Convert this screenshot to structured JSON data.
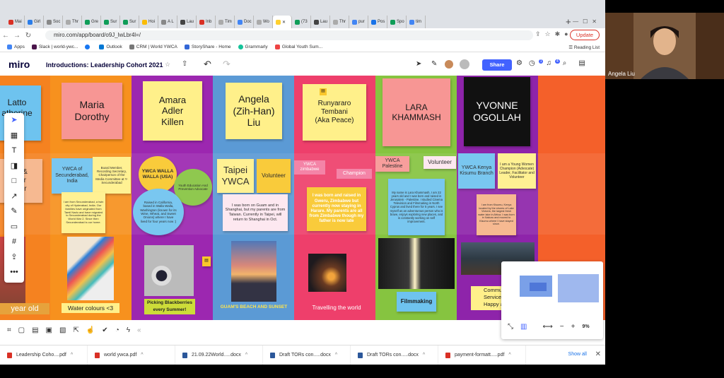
{
  "browser": {
    "tabs": [
      "Mai",
      "Girl",
      "Soc",
      "Thr",
      "Gre",
      "Sur",
      "Sur",
      "Hoi",
      "A L",
      "Lau",
      "Inb",
      "Tim",
      "Doc",
      "Wo",
      "",
      "(73",
      "Lau",
      "Thr",
      "pur",
      "Pos",
      "Spo",
      "tim"
    ],
    "url": "miro.com/app/board/o9J_lwLbr4l=/",
    "update_label": "Update",
    "bookmarks": [
      "Apps",
      "Slack | world-ywc...",
      "Outlook",
      "CRM | World YWCA",
      "StoryShare - Home",
      "Grammarly",
      "Global Youth Sum..."
    ],
    "reading_list": "Reading List"
  },
  "miro": {
    "logo": "miro",
    "board_title": "Introductions: Leadership Cohort 2021",
    "share_label": "Share",
    "badges": {
      "timer": "1",
      "notifications": "4"
    },
    "zoom": "9%"
  },
  "board": {
    "col0": {
      "name_lines": [
        "Latto",
        "atherine",
        "T    o"
      ],
      "role_lines": [
        "HR &",
        "nder",
        "visor"
      ],
      "caption": "year old"
    },
    "col1": {
      "name_lines": [
        "Maria",
        "Dorothy"
      ],
      "org": "YWCA of Secunderabad, India",
      "role": "Board Member, Recording Secretary, Chairperson of the Media Committee at Y-Secunderabad",
      "bio": "I am from Secunderabad, a twin city of Hyderabad, India. Our families have originated from Tamil Nadu and have migrated to Secunderabad during the World War 2. Since then Secunderabad is our home.",
      "caption": "Water colours <3"
    },
    "col2": {
      "name_lines": [
        "Amara",
        "Adler",
        "Killen"
      ],
      "org": "YWCA WALLA WALLA (USA)",
      "role": "Youth Education And Prevention Advocate",
      "bio": "Raised in California, based in Walla Walla, Washington (known for its Wine, Wheat, and Sweet Onions) where I have lived for four years now :)",
      "caption_lines": [
        "Picking Blackberries",
        "every Summer!"
      ]
    },
    "col3": {
      "name_lines": [
        "Angela",
        "(Zih-Han)",
        "Liu"
      ],
      "org_lines": [
        "Taipei",
        "YWCA"
      ],
      "role": "Volunteer",
      "bio": "I was born on Guam and in Shanghai, but my parents are from Taiwan. Currently in Taipei, will return to Shanghai in Oct.",
      "caption": "GUAM'S BEACH AND SUNSET"
    },
    "col4": {
      "name_lines": [
        "Runyararo",
        "Tembani",
        "(Aka Peace)"
      ],
      "org": "YWCA zimbabwe",
      "role": "Champion",
      "bio": "I was born and raised in Gweru, Zimbabwe but currently now staying in Harare. My parents are all from Zimbabwe though my father is now late",
      "caption": "Travelling the world"
    },
    "col5": {
      "name_lines": [
        "LARA",
        "KHAMMASH"
      ],
      "org": "YWCA Palestine",
      "role": "Volunteer",
      "bio": "My name is Lara Khammash, I am 22 years old and I was born and raised in Jerusalem - Palestine. I studied Cinema Television and Filmmaking in North Cyprus and lived there for 5 years. I see myself as an adventurous person who is brave, enjoys exploring new places, and is constantly working on self improvement.",
      "caption": "Filmmaking"
    },
    "col6": {
      "name_lines": [
        "YVONNE",
        "OGOLLAH"
      ],
      "org": "YWCA Kenya Kisumu Branch",
      "role": "I am a Young Women Champion (Advocate) Leader, Facilitator and Volunteer",
      "bio": "I am from Kisumu, Kenya located by the shores of Lake Victoria, the largest fresh water lake in Africa. I was born in Nakuru and moved to Kisumu where I have stayed since.",
      "caption_lines": [
        "Commu",
        "Service Ma",
        "Happy and"
      ]
    }
  },
  "downloads": [
    {
      "name": "Leadership Coho....pdf",
      "type": "pdf"
    },
    {
      "name": "world ywca.pdf",
      "type": "pdf"
    },
    {
      "name": "21.09.22World.....docx",
      "type": "doc"
    },
    {
      "name": "Draft TORs con.....docx",
      "type": "doc"
    },
    {
      "name": "Draft TORs con.....docx",
      "type": "doc"
    },
    {
      "name": "payment-formatt.....pdf",
      "type": "pdf"
    }
  ],
  "show_all": "Show all",
  "video": {
    "participant": "Angela Liu"
  },
  "colors": {
    "orange": "#f58220",
    "purple": "#9c27b0",
    "blue": "#5b9ad5",
    "pink": "#ee3f6b",
    "green": "#86c440",
    "miro_blue": "#4262ff"
  }
}
